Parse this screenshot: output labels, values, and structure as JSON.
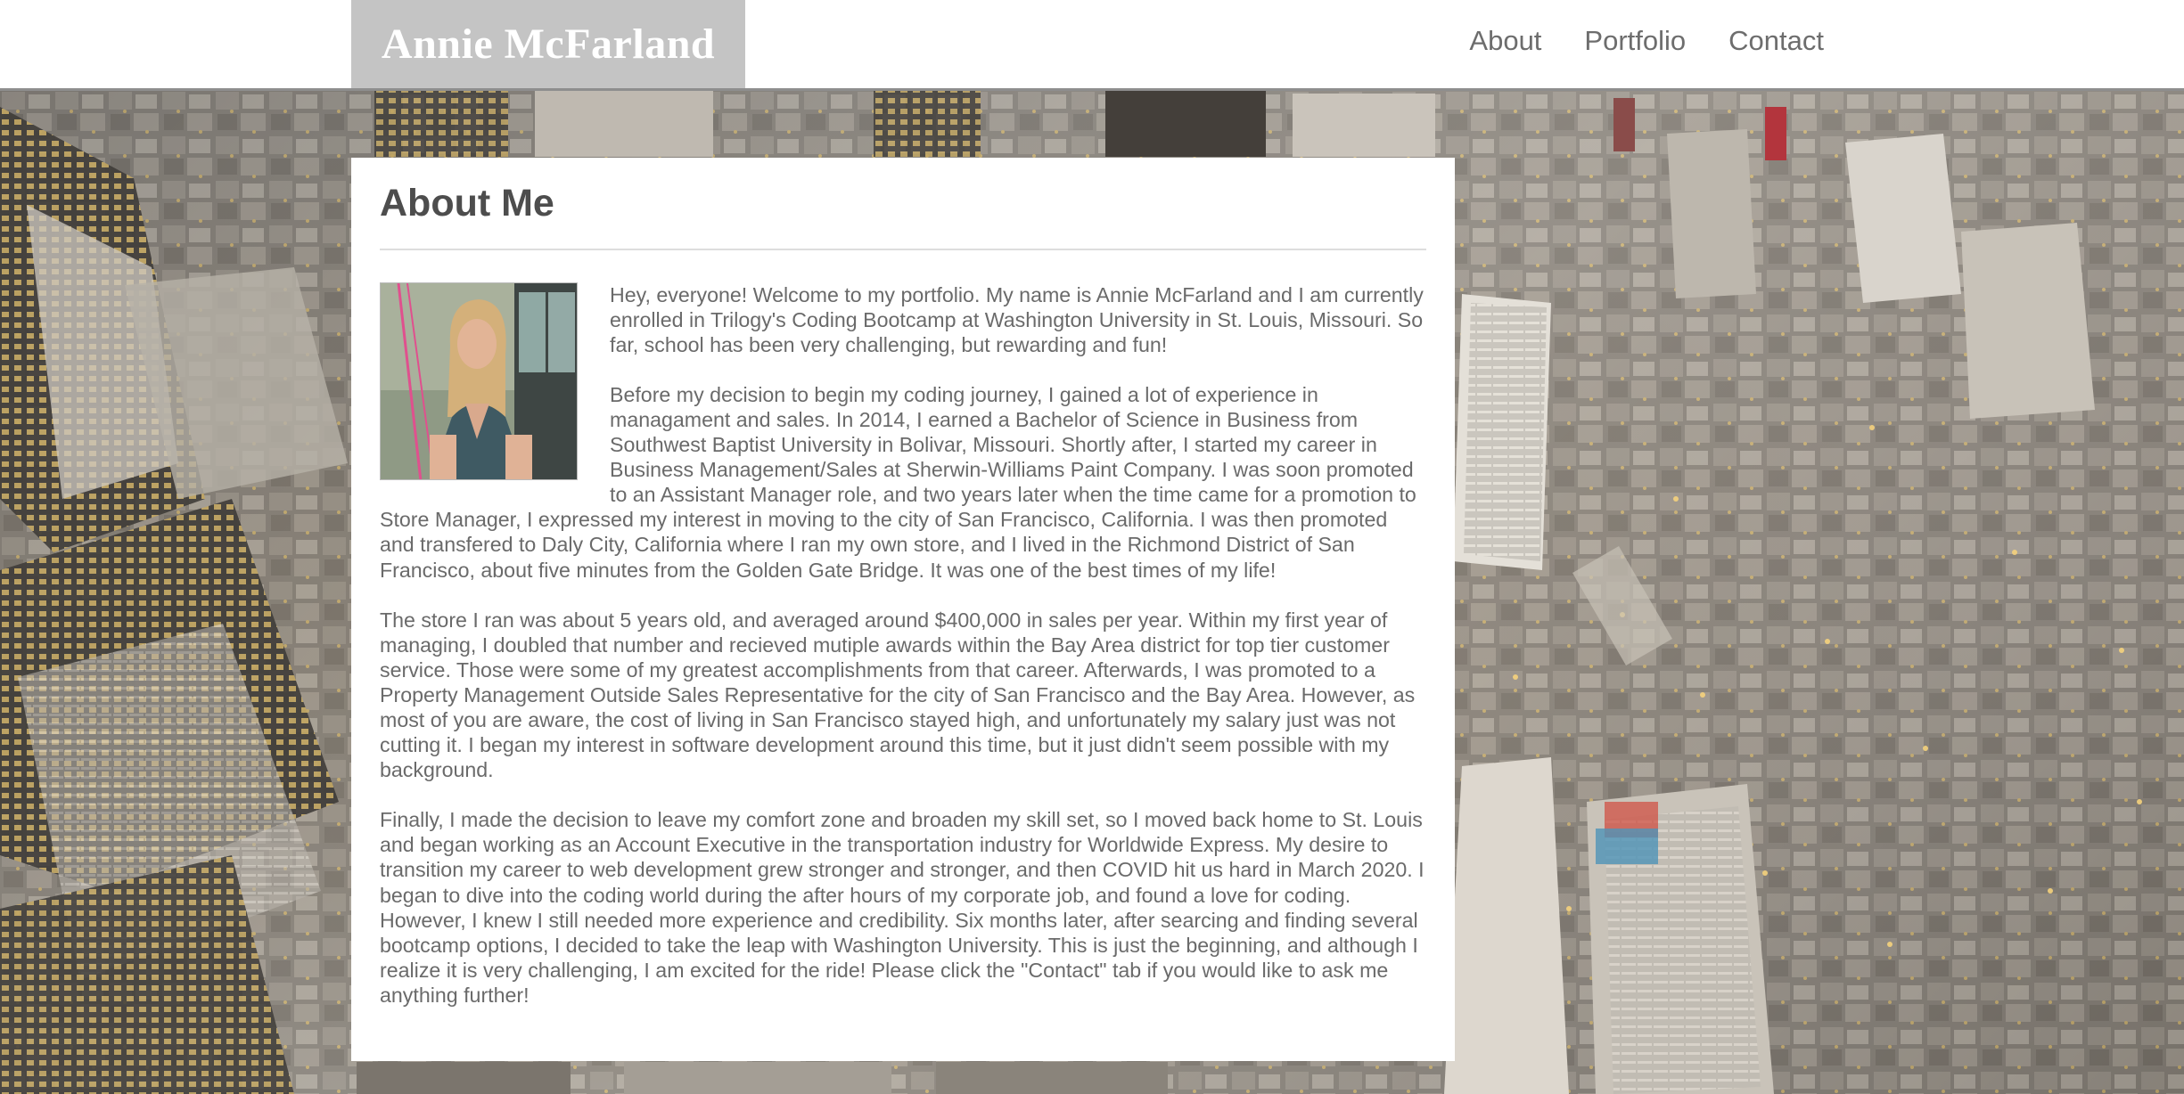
{
  "header": {
    "brand": "Annie McFarland",
    "nav": [
      "About",
      "Portfolio",
      "Contact"
    ]
  },
  "about": {
    "title": "About Me",
    "photo_alt": "photo of Annie McFarland",
    "paragraphs": [
      "Hey, everyone! Welcome to my portfolio. My name is Annie McFarland and I am currently enrolled in Trilogy's Coding Bootcamp at Washington University in St. Louis, Missouri. So far, school has been very challenging, but rewarding and fun!",
      "Before my decision to begin my coding journey, I gained a lot of experience in managament and sales. In 2014, I earned a Bachelor of Science in Business from Southwest Baptist University in Bolivar, Missouri. Shortly after, I started my career in Business Management/Sales at Sherwin-Williams Paint Company. I was soon promoted to an Assistant Manager role, and two years later when the time came for a promotion to Store Manager, I expressed my interest in moving to the city of San Francisco, California. I was then promoted and transfered to Daly City, California where I ran my own store, and I lived in the Richmond District of San Francisco, about five minutes from the Golden Gate Bridge. It was one of the best times of my life!",
      "The store I ran was about 5 years old, and averaged around $400,000 in sales per year. Within my first year of managing, I doubled that number and recieved mutiple awards within the Bay Area district for top tier customer service. Those were some of my greatest accomplishments from that career. Afterwards, I was promoted to a Property Management Outside Sales Representative for the city of San Francisco and the Bay Area. However, as most of you are aware, the cost of living in San Francisco stayed high, and unfortunately my salary just was not cutting it. I began my interest in software development around this time, but it just didn't seem possible with my background.",
      "Finally, I made the decision to leave my comfort zone and broaden my skill set, so I moved back home to St. Louis and began working as an Account Executive in the transportation industry for Worldwide Express. My desire to transition my career to web development grew stronger and stronger, and then COVID hit us hard in March 2020. I began to dive into the coding world during the after hours of my corporate job, and found a love for coding. However, I knew I still needed more experience and credibility. Six months later, after searcing and finding several bootcamp options, I decided to take the leap with Washington University. This is just the beginning, and although I realize it is very challenging, I am excited for the ride! Please click the \"Contact\" tab if you would like to ask me anything further!"
    ]
  }
}
